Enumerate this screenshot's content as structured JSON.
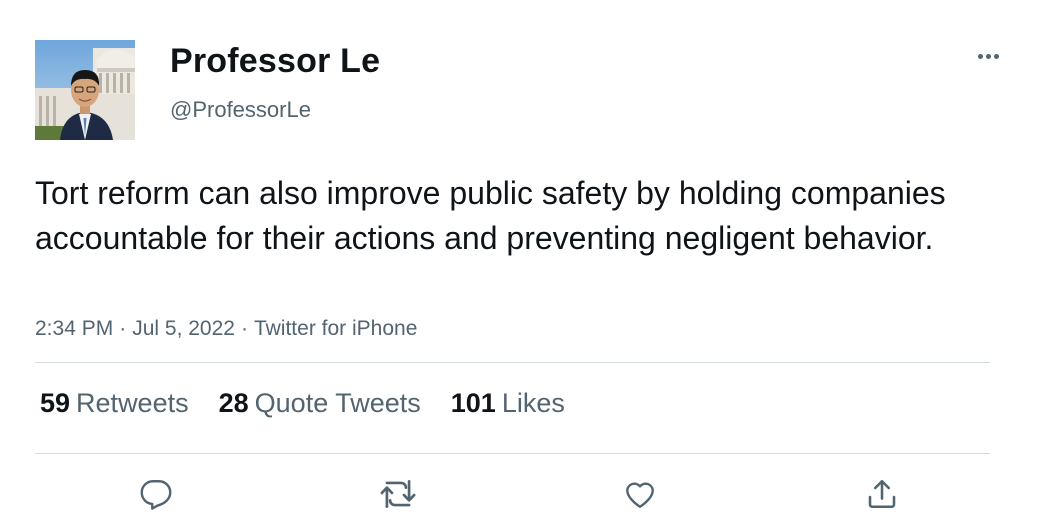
{
  "tweet": {
    "author": {
      "display_name": "Professor Le",
      "handle": "@ProfessorLe",
      "avatar": "profile-photo"
    },
    "more_icon": "more-horizontal-icon",
    "text": "Tort reform can also improve public safety by holding companies accountable for their actions and preventing negligent behavior.",
    "meta": {
      "time": "2:34 PM",
      "separator": "·",
      "date": "Jul 5, 2022",
      "source": "Twitter for iPhone"
    },
    "stats": {
      "retweets": {
        "count": "59",
        "label": "Retweets"
      },
      "quote_tweets": {
        "count": "28",
        "label": "Quote Tweets"
      },
      "likes": {
        "count": "101",
        "label": "Likes"
      }
    },
    "actions": [
      "reply-icon",
      "retweet-icon",
      "like-icon",
      "share-icon"
    ]
  },
  "colors": {
    "text_primary": "#0f1419",
    "text_secondary": "#536471",
    "divider": "#cfd9de",
    "background": "#ffffff"
  }
}
